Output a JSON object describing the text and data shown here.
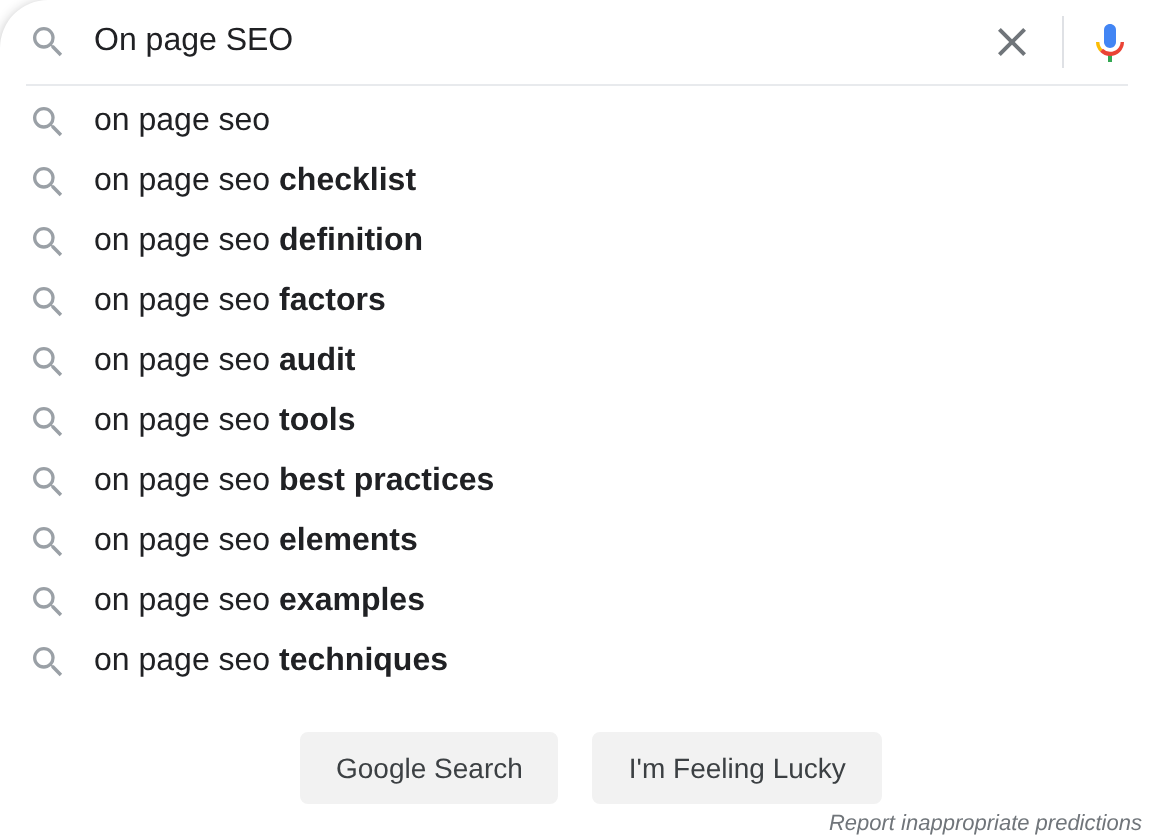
{
  "search": {
    "value": "On page SEO"
  },
  "suggestions": [
    "on page seo",
    "on page seo **checklist**",
    "on page seo **definition**",
    "on page seo **factors**",
    "on page seo **audit**",
    "on page seo **tools**",
    "on page seo **best practices**",
    "on page seo **elements**",
    "on page seo **examples**",
    "on page seo **techniques**"
  ],
  "buttons": [
    "Google Search",
    "I'm Feeling Lucky"
  ],
  "footer_link": "Report inappropriate predictions"
}
